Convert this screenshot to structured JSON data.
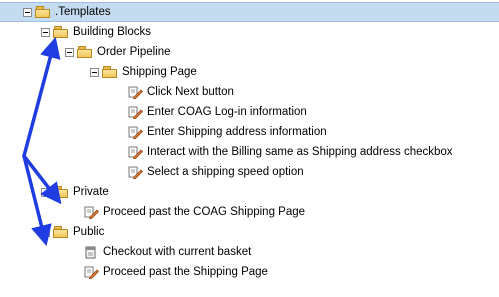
{
  "tree": {
    "root": {
      "label": ".Templates"
    },
    "building_blocks": {
      "label": "Building Blocks"
    },
    "order_pipeline": {
      "label": "Order Pipeline"
    },
    "shipping_page": {
      "label": "Shipping Page"
    },
    "shipping_steps": [
      {
        "label": "Click Next button"
      },
      {
        "label": "Enter COAG Log-in information"
      },
      {
        "label": "Enter Shipping address information"
      },
      {
        "label": "Interact with the Billing same as Shipping address checkbox"
      },
      {
        "label": "Select a shipping speed option"
      }
    ],
    "private": {
      "label": "Private"
    },
    "private_steps": [
      {
        "label": "Proceed past the COAG Shipping Page"
      }
    ],
    "public": {
      "label": "Public"
    },
    "public_items": [
      {
        "label": "Checkout with current basket",
        "icon": "document-icon"
      },
      {
        "label": "Proceed past the Shipping Page",
        "icon": "step-icon"
      }
    ]
  },
  "colors": {
    "selection": "#c5dcf0",
    "arrow": "#1f3de0",
    "folder": "#f3c75a"
  }
}
